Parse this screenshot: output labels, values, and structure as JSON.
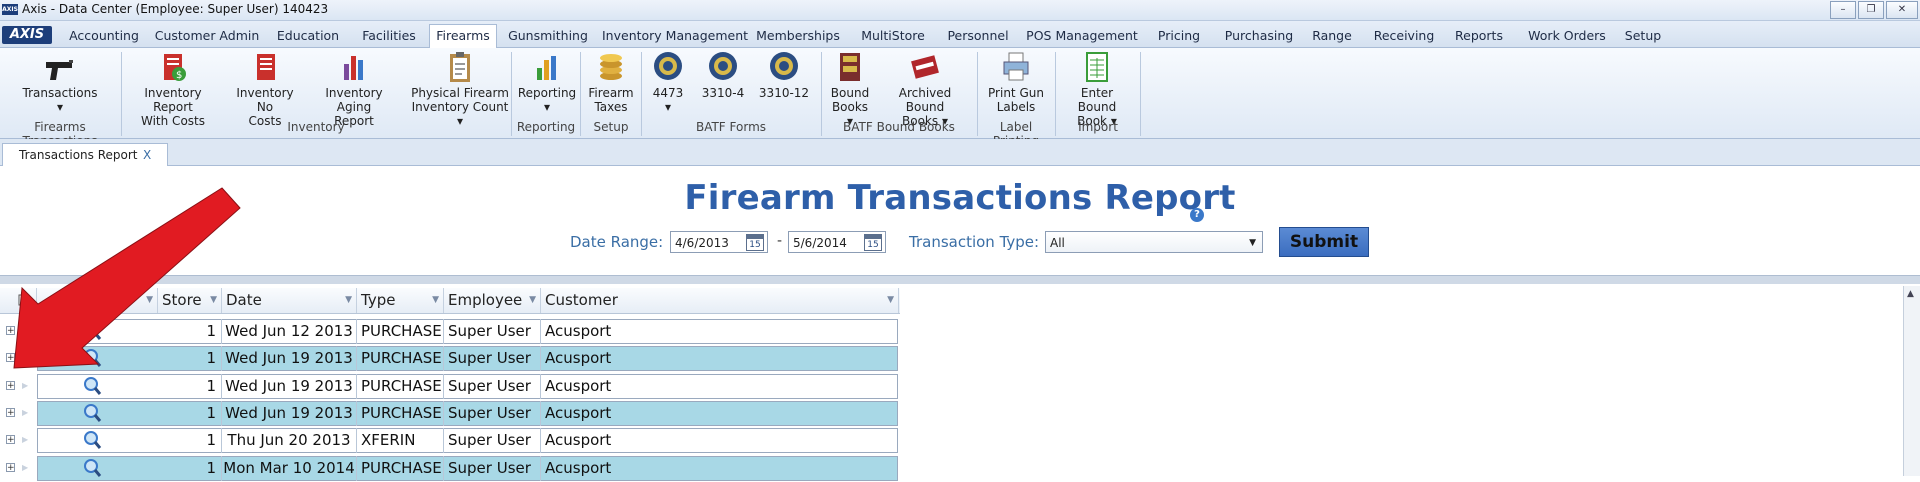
{
  "window": {
    "app_logo": "AXIS",
    "title": "Axis - Data Center  (Employee: Super User) 140423",
    "minimize": "–",
    "restore": "❐",
    "close": "✕"
  },
  "menubar": {
    "logo": "AXIS",
    "tabs": [
      {
        "label": "Accounting"
      },
      {
        "label": "Customer Admin"
      },
      {
        "label": "Education"
      },
      {
        "label": "Facilities"
      },
      {
        "label": "Firearms"
      },
      {
        "label": "Gunsmithing"
      },
      {
        "label": "Inventory Management"
      },
      {
        "label": "Memberships"
      },
      {
        "label": "MultiStore"
      },
      {
        "label": "Personnel"
      },
      {
        "label": "POS Management"
      },
      {
        "label": "Pricing"
      },
      {
        "label": "Purchasing"
      },
      {
        "label": "Range"
      },
      {
        "label": "Receiving"
      },
      {
        "label": "Reports"
      },
      {
        "label": "Work Orders"
      },
      {
        "label": "Setup"
      }
    ],
    "active_tab": "Firearms"
  },
  "ribbon": {
    "buttons": [
      {
        "line1": "Transactions",
        "line2": "▾",
        "icon": "pistol-icon"
      },
      {
        "line1": "Inventory Report",
        "line2": "With Costs",
        "icon": "report-dollar-icon"
      },
      {
        "line1": "Inventory No",
        "line2": "Costs",
        "icon": "report-icon"
      },
      {
        "line1": "Inventory Aging",
        "line2": "Report",
        "icon": "aging-report-icon"
      },
      {
        "line1": "Physical Firearm",
        "line2": "Inventory Count ▾",
        "icon": "clipboard-icon"
      },
      {
        "line1": "Reporting",
        "line2": "▾",
        "icon": "bar-chart-icon"
      },
      {
        "line1": "Firearm",
        "line2": "Taxes",
        "icon": "coins-icon"
      },
      {
        "line1": "4473",
        "line2": "▾",
        "icon": "batf-seal-icon"
      },
      {
        "line1": "3310-4",
        "line2": "",
        "icon": "batf-seal-icon"
      },
      {
        "line1": "3310-12",
        "line2": "",
        "icon": "batf-seal-icon"
      },
      {
        "line1": "Bound",
        "line2": "Books ▾",
        "icon": "bound-book-icon"
      },
      {
        "line1": "Archived Bound",
        "line2": "Books ▾",
        "icon": "archived-book-icon"
      },
      {
        "line1": "Print Gun",
        "line2": "Labels",
        "icon": "printer-icon"
      },
      {
        "line1": "Enter Bound",
        "line2": "Book ▾",
        "icon": "spreadsheet-icon"
      }
    ],
    "groups": [
      {
        "label": "Firearms Transactions"
      },
      {
        "label": "Inventory"
      },
      {
        "label": "Reporting"
      },
      {
        "label": "Setup"
      },
      {
        "label": "BATF Forms"
      },
      {
        "label": "BATF Bound Books"
      },
      {
        "label": "Label Printing"
      },
      {
        "label": "Import"
      }
    ]
  },
  "doc_tab": {
    "label": "Transactions Report",
    "close": "X"
  },
  "report": {
    "title": "Firearm Transactions Report",
    "help": "?",
    "date_range_label": "Date Range:",
    "date_from": "4/6/2013",
    "date_to": "5/6/2014",
    "date_sep": "-",
    "calendar_day": "15",
    "transaction_type_label": "Transaction Type:",
    "transaction_type": "All",
    "submit": "Submit"
  },
  "grid": {
    "columns": [
      "Store",
      "Date",
      "Type",
      "Employee",
      "Customer"
    ],
    "rows": [
      {
        "store": "1",
        "date": "Wed Jun 12 2013",
        "type": "PURCHASE",
        "employee": "Super User",
        "customer": "Acusport"
      },
      {
        "store": "1",
        "date": "Wed Jun 19 2013",
        "type": "PURCHASE",
        "employee": "Super User",
        "customer": "Acusport"
      },
      {
        "store": "1",
        "date": "Wed Jun 19 2013",
        "type": "PURCHASE",
        "employee": "Super User",
        "customer": "Acusport"
      },
      {
        "store": "1",
        "date": "Wed Jun 19 2013",
        "type": "PURCHASE",
        "employee": "Super User",
        "customer": "Acusport"
      },
      {
        "store": "1",
        "date": "Thu Jun 20 2013",
        "type": "XFERIN",
        "employee": "Super User",
        "customer": "Acusport"
      },
      {
        "store": "1",
        "date": "Mon Mar 10 2014",
        "type": "PURCHASE",
        "employee": "Super User",
        "customer": "Acusport"
      }
    ],
    "expander": "+"
  },
  "colors": {
    "title_blue": "#2e5fa9",
    "row_alt": "#a8d8e6",
    "arrow_red": "#e11b22"
  }
}
